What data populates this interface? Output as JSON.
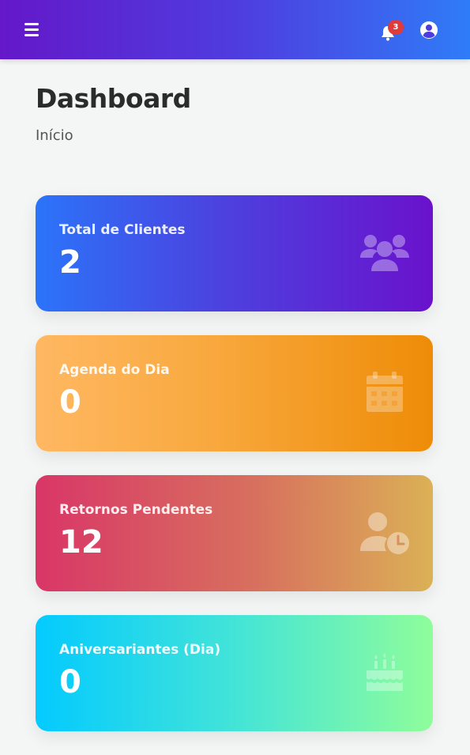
{
  "header": {
    "notifications_count": "3",
    "colors": {
      "gradient_start": "#6418c9",
      "gradient_end": "#2f7cf8",
      "badge": "#e03b3b"
    },
    "icons": [
      "menu-icon",
      "bell-icon",
      "user-circle-icon"
    ]
  },
  "page": {
    "title": "Dashboard",
    "breadcrumb": "Início"
  },
  "cards": [
    {
      "label": "Total de Clientes",
      "value": "2",
      "icon": "users-icon",
      "gradient": [
        "#2b74f9",
        "#6a12cc"
      ]
    },
    {
      "label": "Agenda do Dia",
      "value": "0",
      "icon": "calendar-icon",
      "gradient": [
        "#ffb862",
        "#ee8c07"
      ]
    },
    {
      "label": "Retornos Pendentes",
      "value": "12",
      "icon": "user-clock-icon",
      "gradient": [
        "#d93667",
        "#dbb156"
      ]
    },
    {
      "label": "Aniversariantes (Dia)",
      "value": "0",
      "icon": "birthday-cake-icon",
      "gradient": [
        "#03caff",
        "#8ffd9b"
      ]
    }
  ]
}
